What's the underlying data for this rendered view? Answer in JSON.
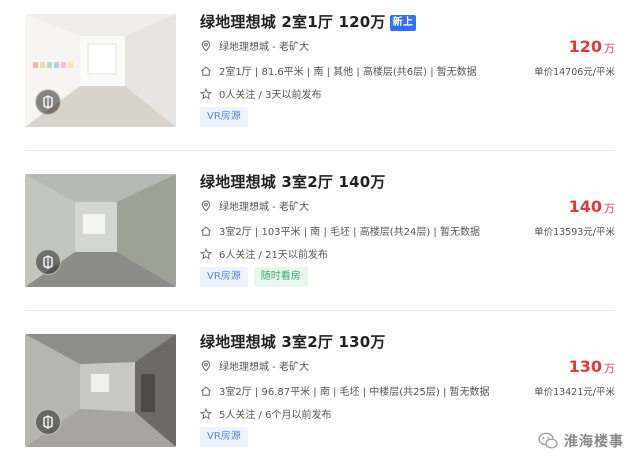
{
  "listings": [
    {
      "title": "绿地理想城 2室1厅 120万",
      "badge": "新上",
      "community": "绿地理想城 - 老矿大",
      "info": "2室1厅 | 81.6平米 | 南 | 其他 | 高楼层(共6层) | 暂无数据",
      "follow": "0人关注 / 3天以前发布",
      "tags": [
        "VR房源"
      ],
      "price": "120",
      "price_unit": "万",
      "unit_price": "单价14706元/平米"
    },
    {
      "title": "绿地理想城 3室2厅 140万",
      "badge": "",
      "community": "绿地理想城 - 老矿大",
      "info": "3室2厅 | 103平米 | 南 | 毛坯 | 高楼层(共24层) | 暂无数据",
      "follow": "6人关注 / 21天以前发布",
      "tags": [
        "VR房源",
        "随时看房"
      ],
      "price": "140",
      "price_unit": "万",
      "unit_price": "单价13593元/平米"
    },
    {
      "title": "绿地理想城 3室2厅 130万",
      "badge": "",
      "community": "绿地理想城 - 老矿大",
      "info": "3室2厅 | 96.87平米 | 南 | 毛坯 | 中楼层(共25层) | 暂无数据",
      "follow": "5人关注 / 6个月以前发布",
      "tags": [
        "VR房源"
      ],
      "price": "130",
      "price_unit": "万",
      "unit_price": "单价13421元/平米"
    }
  ],
  "watermark": "淮海楼事",
  "colors": {
    "price": "#e4393c",
    "new_badge": "#3072f6",
    "vr_tag_text": "#5a86d6",
    "visit_tag_text": "#3fa86a"
  },
  "icons": {
    "community": "location-pin-icon",
    "info": "house-icon",
    "follow": "star-icon",
    "thumb_badge": "vr-icon",
    "watermark": "wechat-icon"
  }
}
